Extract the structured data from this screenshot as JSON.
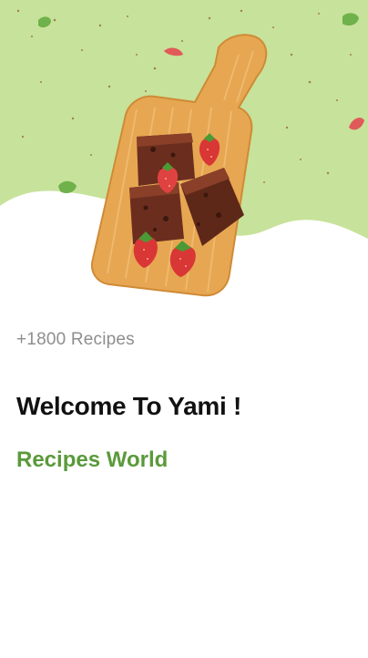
{
  "hero": {
    "image": "brownies-on-cutting-board-illustration",
    "background_color": "#c7e29a",
    "accent_color": "#5a9a3a"
  },
  "intro": {
    "recipe_count": "+1800 Recipes",
    "title": "Welcome To Yami !",
    "subtitle": "Recipes World"
  }
}
